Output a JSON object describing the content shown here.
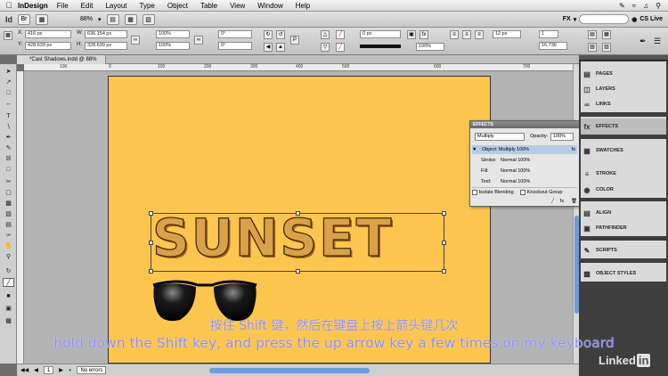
{
  "menubar": {
    "app_name": "InDesign",
    "items": [
      "File",
      "Edit",
      "Layout",
      "Type",
      "Object",
      "Table",
      "View",
      "Window",
      "Help"
    ]
  },
  "appbar": {
    "zoom": "88%",
    "workspace": "FX",
    "cs_live": "CS Live"
  },
  "control": {
    "x": "416 px",
    "y": "428.639 px",
    "w": "636.154 px",
    "h": "328.639 px",
    "scale_x": "100%",
    "scale_y": "100%",
    "rotate": "0°",
    "shear": "0°",
    "stroke_weight": "0 px",
    "opacity": "100%",
    "col_count": "12 px",
    "gutter": "16.736",
    "width1": "1"
  },
  "document": {
    "tab_title": "*Cast Shadows.indd @ 88%"
  },
  "rulers": {
    "h_ticks": [
      "100",
      "0",
      "100",
      "200",
      "300",
      "400",
      "500",
      "600",
      "700",
      "800"
    ]
  },
  "artwork": {
    "headline": "SUNSET"
  },
  "effects": {
    "title": "EFFECTS",
    "blend_mode": "Multiply",
    "opacity_label": "Opacity:",
    "opacity_value": "100%",
    "object_row": "Object: Multiply 100%",
    "stroke_label": "Stroke:",
    "stroke_value": "Normal 100%",
    "fill_label": "Fill:",
    "fill_value": "Normal 100%",
    "text_label": "Text:",
    "text_value": "Normal 100%",
    "isolate": "Isolate Blending",
    "knockout": "Knockout Group"
  },
  "panels": [
    {
      "label": "PAGES",
      "icon": "pages-icon"
    },
    {
      "label": "LAYERS",
      "icon": "layers-icon"
    },
    {
      "label": "LINKS",
      "icon": "links-icon"
    },
    {
      "label": "EFFECTS",
      "icon": "fx-icon"
    },
    {
      "label": "SWATCHES",
      "icon": "swatches-icon"
    },
    {
      "label": "STROKE",
      "icon": "stroke-icon"
    },
    {
      "label": "COLOR",
      "icon": "color-icon"
    },
    {
      "label": "ALIGN",
      "icon": "align-icon"
    },
    {
      "label": "PATHFINDER",
      "icon": "pathfinder-icon"
    },
    {
      "label": "SCRIPTS",
      "icon": "scripts-icon"
    },
    {
      "label": "OBJECT STYLES",
      "icon": "object-styles-icon"
    }
  ],
  "status": {
    "page": "1",
    "errors": "No errors"
  },
  "subtitles": {
    "cn": "按住 Shift 键，然后在键盘上按上箭头键几次",
    "en": "hold down the Shift key, and press the  up arrow key a few times on my keyboard"
  },
  "watermark": {
    "brand": "Linked",
    "in": "in"
  }
}
